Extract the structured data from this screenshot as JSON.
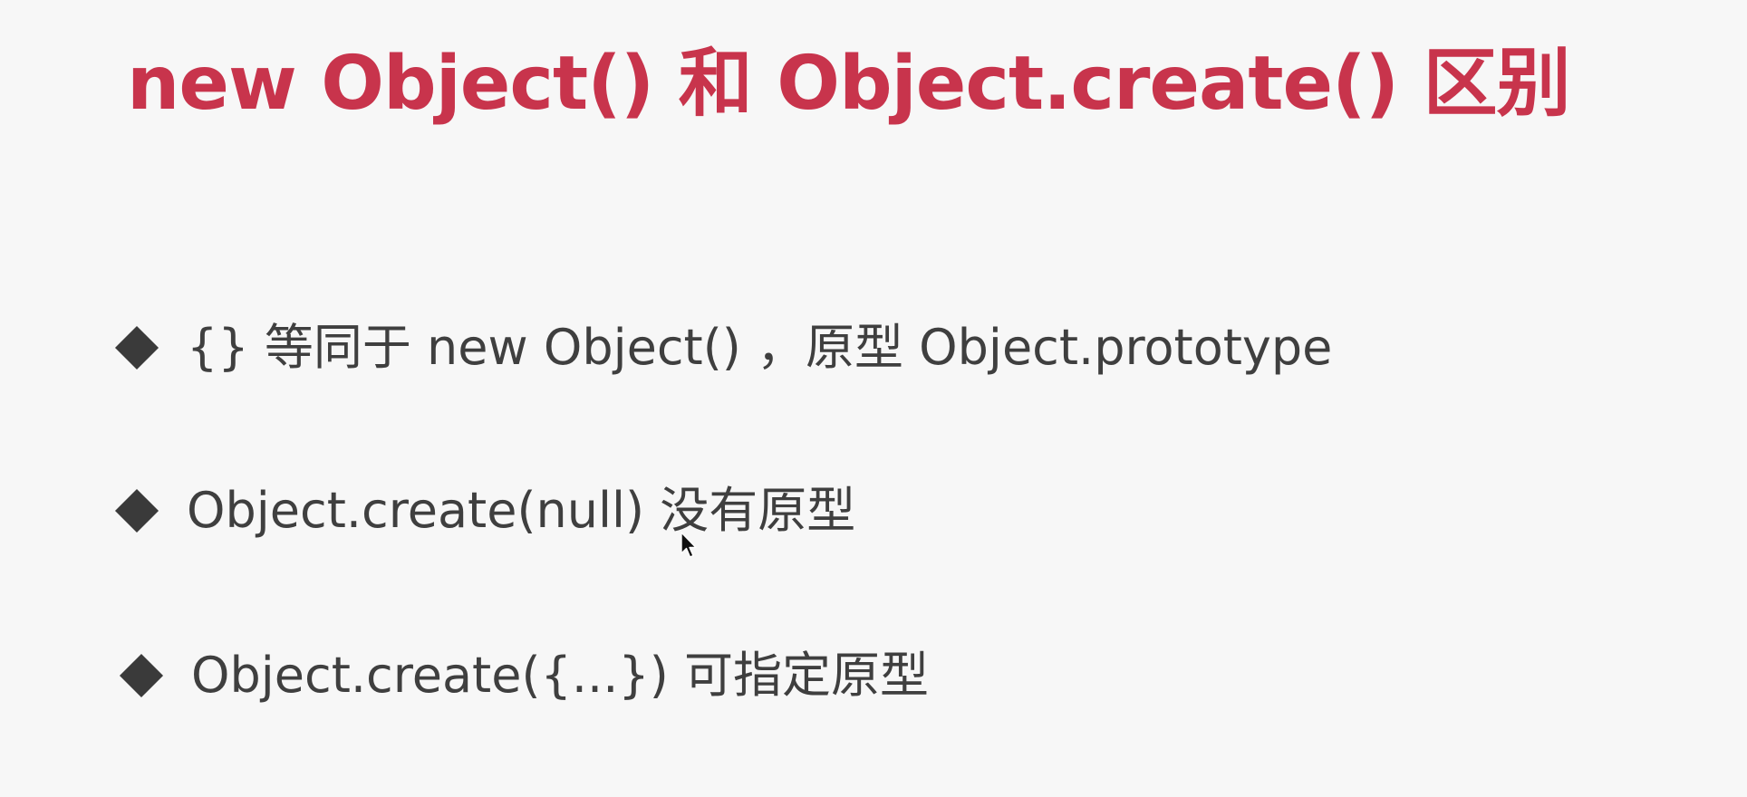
{
  "slide": {
    "title": "new Object() 和 Object.create() 区别",
    "bullets": [
      {
        "text": "{} 等同于 new Object()  ，原型 Object.prototype"
      },
      {
        "text": "Object.create(null) 没有原型"
      },
      {
        "text": "Object.create({...}) 可指定原型"
      }
    ]
  },
  "colors": {
    "title": "#c8344c",
    "text": "#3f3f3f",
    "bullet": "#3a3a3a",
    "background": "#f7f7f7"
  },
  "icons": {
    "bullet": "diamond-bullet-icon",
    "cursor": "mouse-pointer-icon"
  }
}
